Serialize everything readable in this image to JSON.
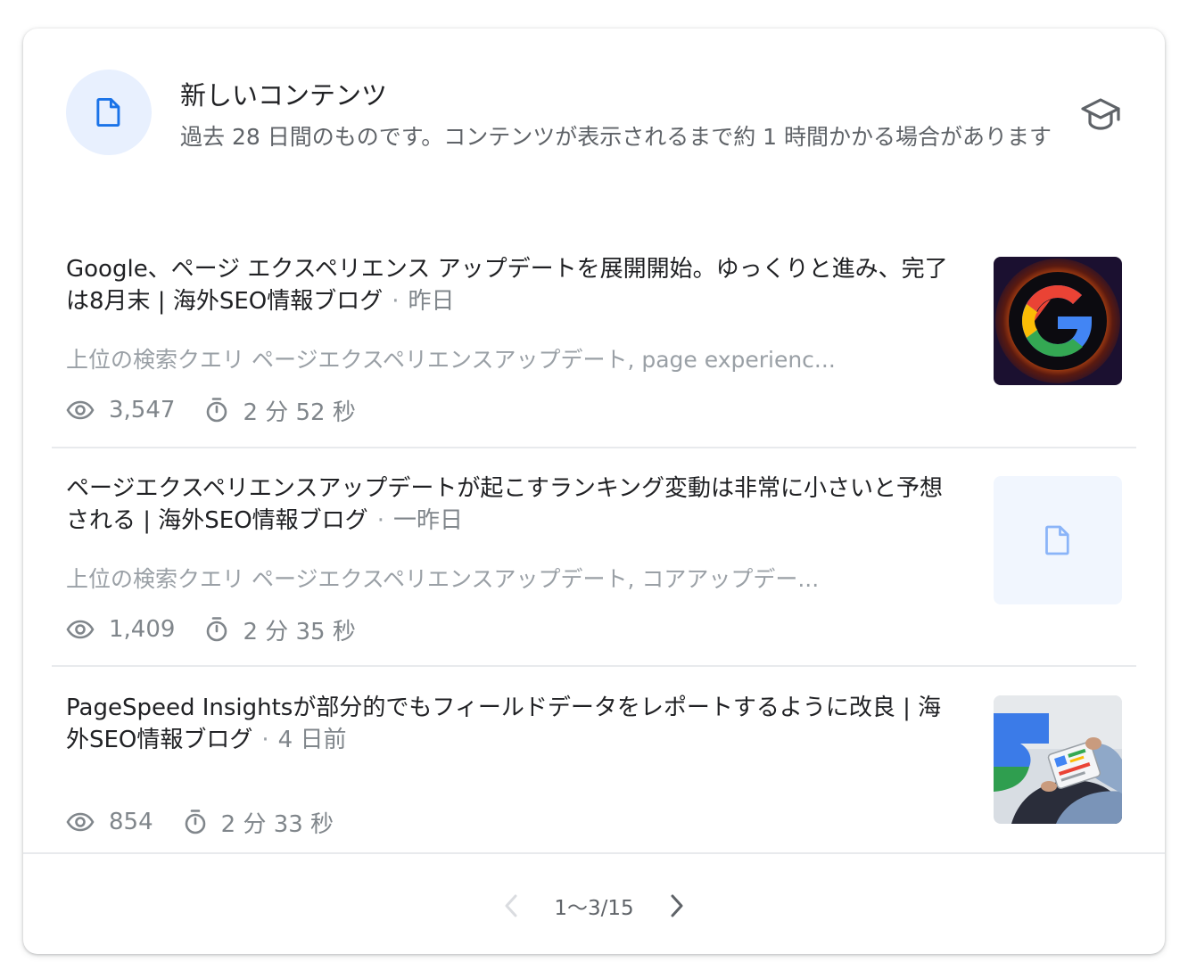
{
  "header": {
    "title": "新しいコンテンツ",
    "subtitle": "過去 28 日間のものです。コンテンツが表示されるまで約 1 時間かかる場合があります",
    "icon": "document-icon",
    "learn_icon": "school-icon"
  },
  "items": [
    {
      "title": "Google、ページ エクスペリエンス アップデートを展開開始。ゆっくりと進み、完了は8月末 | 海外SEO情報ブログ",
      "separator": "·",
      "date": "昨日",
      "query_label": "上位の検索クエリ",
      "queries": "ページエクスペリエンスアップデート, page experienc...",
      "views": "3,547",
      "duration": "2 分 52 秒",
      "thumbnail": "google-logo-thumbnail"
    },
    {
      "title": "ページエクスペリエンスアップデートが起こすランキング変動は非常に小さいと予想される | 海外SEO情報ブログ",
      "separator": "·",
      "date": "一昨日",
      "query_label": "上位の検索クエリ",
      "queries": "ページエクスペリエンスアップデート, コアアップデー...",
      "views": "1,409",
      "duration": "2 分 35 秒",
      "thumbnail": "document-placeholder"
    },
    {
      "title": "PageSpeed Insightsが部分的でもフィールドデータをレポートするように改良 | 海外SEO情報ブログ",
      "separator": "·",
      "date": "4 日前",
      "views": "854",
      "duration": "2 分 33 秒",
      "thumbnail": "tablet-photo-thumbnail"
    }
  ],
  "pagination": {
    "label": "1〜3/15",
    "prev_icon": "chevron-left-icon",
    "next_icon": "chevron-right-icon"
  },
  "colors": {
    "accent": "#1a73e8",
    "icon_bg": "#e8f0fe",
    "text_primary": "#202124",
    "text_secondary": "#5f6368"
  }
}
